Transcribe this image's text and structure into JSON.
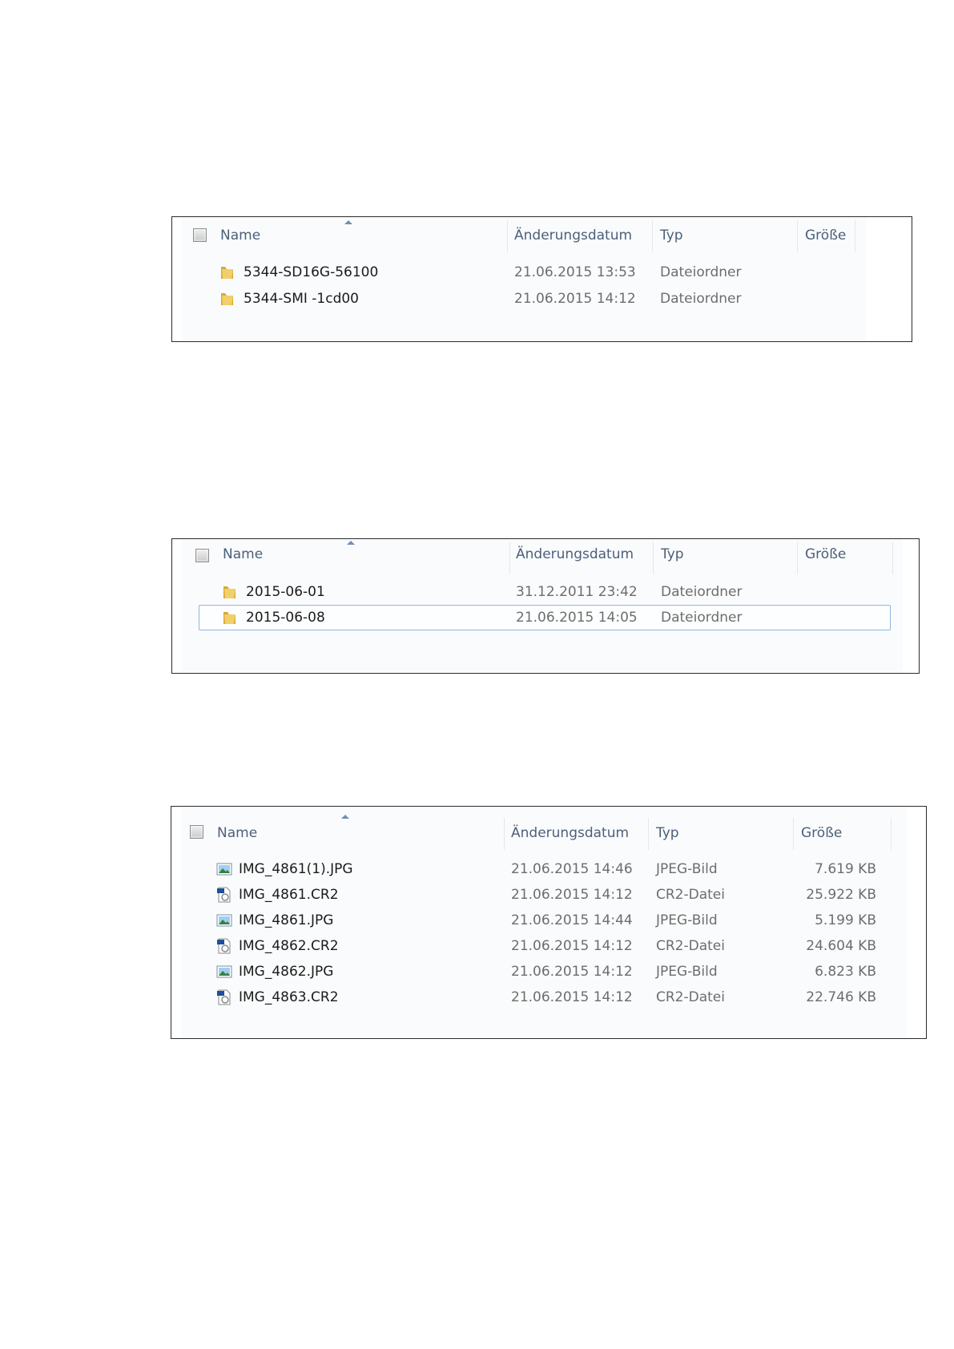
{
  "headers": {
    "name": "Name",
    "date": "Änderungsdatum",
    "type": "Typ",
    "size": "Größe"
  },
  "panel1": {
    "rows": [
      {
        "icon": "folder-icon",
        "name": "5344-SD16G-56100",
        "date": "21.06.2015 13:53",
        "type": "Dateiordner",
        "size": ""
      },
      {
        "icon": "folder-icon",
        "name": "5344-SMI -1cd00",
        "date": "21.06.2015 14:12",
        "type": "Dateiordner",
        "size": ""
      }
    ]
  },
  "panel2": {
    "rows": [
      {
        "icon": "folder-icon",
        "name": "2015-06-01",
        "date": "31.12.2011 23:42",
        "type": "Dateiordner",
        "size": ""
      },
      {
        "icon": "folder-icon",
        "name": "2015-06-08",
        "date": "21.06.2015 14:05",
        "type": "Dateiordner",
        "size": "",
        "selected": true
      }
    ]
  },
  "panel3": {
    "rows": [
      {
        "icon": "jpeg-image-icon",
        "name": "IMG_4861(1).JPG",
        "date": "21.06.2015 14:46",
        "type": "JPEG-Bild",
        "size": "7.619 KB"
      },
      {
        "icon": "cr2-file-icon",
        "name": "IMG_4861.CR2",
        "date": "21.06.2015 14:12",
        "type": "CR2-Datei",
        "size": "25.922 KB"
      },
      {
        "icon": "jpeg-image-icon",
        "name": "IMG_4861.JPG",
        "date": "21.06.2015 14:44",
        "type": "JPEG-Bild",
        "size": "5.199 KB"
      },
      {
        "icon": "cr2-file-icon",
        "name": "IMG_4862.CR2",
        "date": "21.06.2015 14:12",
        "type": "CR2-Datei",
        "size": "24.604 KB"
      },
      {
        "icon": "jpeg-image-icon",
        "name": "IMG_4862.JPG",
        "date": "21.06.2015 14:12",
        "type": "JPEG-Bild",
        "size": "6.823 KB"
      },
      {
        "icon": "cr2-file-icon",
        "name": "IMG_4863.CR2",
        "date": "21.06.2015 14:12",
        "type": "CR2-Datei",
        "size": "22.746 KB"
      }
    ]
  },
  "colors": {
    "header_text": "#4c607a",
    "selection_border": "#8fb5e0",
    "folder": "#e8c25a"
  }
}
